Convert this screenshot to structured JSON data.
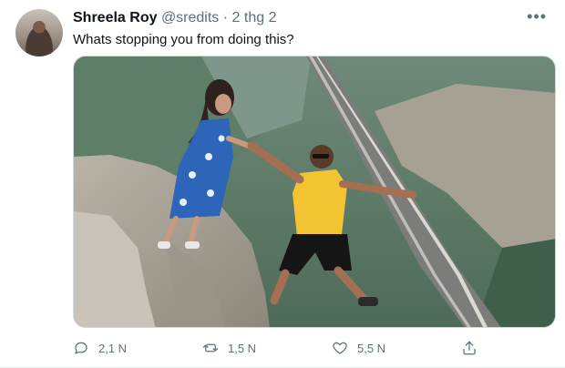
{
  "tweet": {
    "author_name": "Shreela Roy",
    "author_handle": "@sredits",
    "separator": "·",
    "timestamp": "2 thg 2",
    "more_icon": "more-dots-icon",
    "text": "Whats stopping you from doing this?",
    "media_icon": "photo",
    "stats": {
      "replies": "2,1 N",
      "retweets": "1,5 N",
      "likes": "5,5 N"
    },
    "icons": {
      "reply": "reply-icon",
      "retweet": "retweet-icon",
      "like": "heart-icon",
      "share": "share-icon"
    }
  }
}
